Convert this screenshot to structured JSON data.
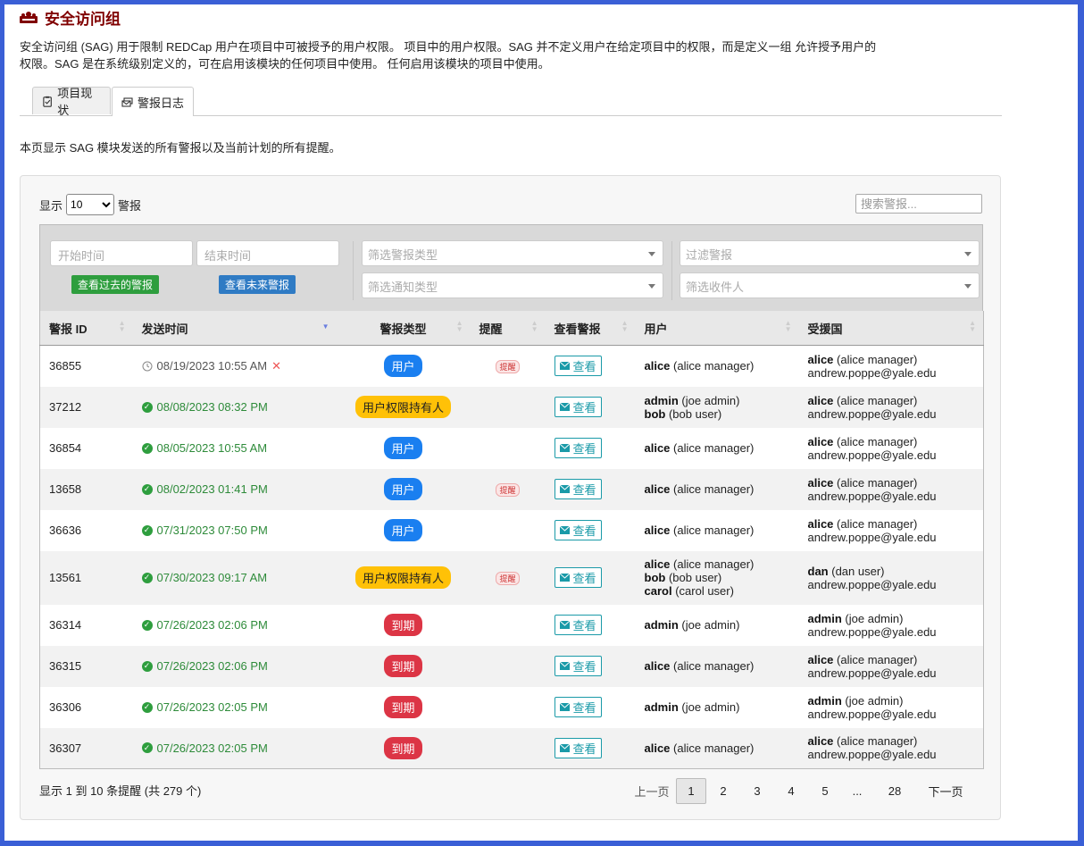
{
  "header": {
    "title": "安全访问组",
    "icon": "users-group-icon"
  },
  "description": "安全访问组 (SAG) 用于限制 REDCap 用户在项目中可被授予的用户权限。 项目中的用户权限。SAG 并不定义用户在给定项目中的权限，而是定义一组 允许授予用户的权限。SAG 是在系统级别定义的，可在启用该模块的任何项目中使用。 任何启用该模块的项目中使用。",
  "tabs": [
    {
      "label": "项目现状",
      "icon": "clipboard-check-icon"
    },
    {
      "label": "警报日志",
      "icon": "envelope-stack-icon"
    }
  ],
  "intro": "本页显示 SAG 模块发送的所有警报以及当前计划的所有提醒。",
  "length": {
    "prefix": "显示",
    "value": "10",
    "suffix": "警报"
  },
  "search": {
    "placeholder": "搜索警报..."
  },
  "filters": {
    "start": "开始时间",
    "end": "结束时间",
    "past_btn": "查看过去的警报",
    "future_btn": "查看未来警报",
    "alert_type": "筛选警报类型",
    "notice_type": "筛选通知类型",
    "filter_alert": "过滤警报",
    "recipient": "筛选收件人"
  },
  "columns": [
    "警报 ID",
    "发送时间",
    "警报类型",
    "提醒",
    "查看警报",
    "用户",
    "受援国"
  ],
  "view_label": "查看",
  "reminder_label": "提醒",
  "rows": [
    {
      "id": "36855",
      "time": "08/19/2023 10:55 AM",
      "scheduled": true,
      "type": "用户",
      "kind": "user",
      "reminder": true,
      "users": [
        {
          "u": "alice",
          "n": "(alice manager)"
        }
      ],
      "rec": [
        {
          "u": "alice",
          "n": "(alice manager)"
        }
      ],
      "email": "andrew.poppe@yale.edu"
    },
    {
      "id": "37212",
      "time": "08/08/2023 08:32 PM",
      "scheduled": false,
      "type": "用户权限持有人",
      "kind": "holder",
      "reminder": false,
      "users": [
        {
          "u": "admin",
          "n": "(joe admin)"
        },
        {
          "u": "bob",
          "n": "(bob user)"
        }
      ],
      "rec": [
        {
          "u": "alice",
          "n": "(alice manager)"
        }
      ],
      "email": "andrew.poppe@yale.edu"
    },
    {
      "id": "36854",
      "time": "08/05/2023 10:55 AM",
      "scheduled": false,
      "type": "用户",
      "kind": "user",
      "reminder": false,
      "users": [
        {
          "u": "alice",
          "n": "(alice manager)"
        }
      ],
      "rec": [
        {
          "u": "alice",
          "n": "(alice manager)"
        }
      ],
      "email": "andrew.poppe@yale.edu"
    },
    {
      "id": "13658",
      "time": "08/02/2023 01:41 PM",
      "scheduled": false,
      "type": "用户",
      "kind": "user",
      "reminder": true,
      "users": [
        {
          "u": "alice",
          "n": "(alice manager)"
        }
      ],
      "rec": [
        {
          "u": "alice",
          "n": "(alice manager)"
        }
      ],
      "email": "andrew.poppe@yale.edu"
    },
    {
      "id": "36636",
      "time": "07/31/2023 07:50 PM",
      "scheduled": false,
      "type": "用户",
      "kind": "user",
      "reminder": false,
      "users": [
        {
          "u": "alice",
          "n": "(alice manager)"
        }
      ],
      "rec": [
        {
          "u": "alice",
          "n": "(alice manager)"
        }
      ],
      "email": "andrew.poppe@yale.edu"
    },
    {
      "id": "13561",
      "time": "07/30/2023 09:17 AM",
      "scheduled": false,
      "type": "用户权限持有人",
      "kind": "holder",
      "reminder": true,
      "users": [
        {
          "u": "alice",
          "n": "(alice manager)"
        },
        {
          "u": "bob",
          "n": "(bob user)"
        },
        {
          "u": "carol",
          "n": "(carol user)"
        }
      ],
      "rec": [
        {
          "u": "dan",
          "n": "(dan user)"
        }
      ],
      "email": "andrew.poppe@yale.edu"
    },
    {
      "id": "36314",
      "time": "07/26/2023 02:06 PM",
      "scheduled": false,
      "type": "到期",
      "kind": "exp",
      "reminder": false,
      "users": [
        {
          "u": "admin",
          "n": "(joe admin)"
        }
      ],
      "rec": [
        {
          "u": "admin",
          "n": "(joe admin)"
        }
      ],
      "email": "andrew.poppe@yale.edu"
    },
    {
      "id": "36315",
      "time": "07/26/2023 02:06 PM",
      "scheduled": false,
      "type": "到期",
      "kind": "exp",
      "reminder": false,
      "users": [
        {
          "u": "alice",
          "n": "(alice manager)"
        }
      ],
      "rec": [
        {
          "u": "alice",
          "n": "(alice manager)"
        }
      ],
      "email": "andrew.poppe@yale.edu"
    },
    {
      "id": "36306",
      "time": "07/26/2023 02:05 PM",
      "scheduled": false,
      "type": "到期",
      "kind": "exp",
      "reminder": false,
      "users": [
        {
          "u": "admin",
          "n": "(joe admin)"
        }
      ],
      "rec": [
        {
          "u": "admin",
          "n": "(joe admin)"
        }
      ],
      "email": "andrew.poppe@yale.edu"
    },
    {
      "id": "36307",
      "time": "07/26/2023 02:05 PM",
      "scheduled": false,
      "type": "到期",
      "kind": "exp",
      "reminder": false,
      "users": [
        {
          "u": "alice",
          "n": "(alice manager)"
        }
      ],
      "rec": [
        {
          "u": "alice",
          "n": "(alice manager)"
        }
      ],
      "email": "andrew.poppe@yale.edu"
    }
  ],
  "footer": {
    "info": "显示 1 到 10 条提醒 (共 279 个)"
  },
  "pager": {
    "prev": "上一页",
    "pages": [
      "1",
      "2",
      "3",
      "4",
      "5",
      "...",
      "28"
    ],
    "current": "1",
    "next": "下一页"
  },
  "colors": {
    "brand": "#800000",
    "green": "#2e9e3e",
    "blue_btn": "#2f7bc4",
    "teal": "#1a9aa8"
  }
}
